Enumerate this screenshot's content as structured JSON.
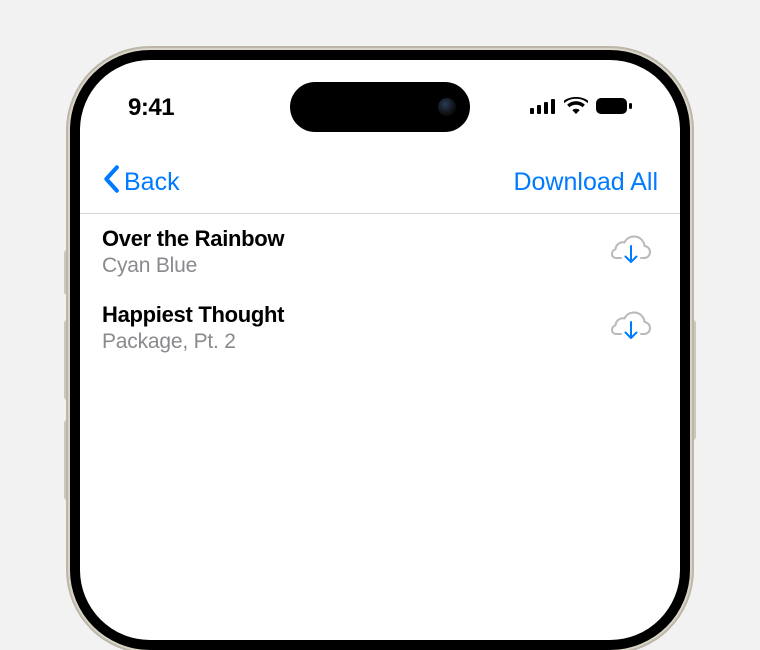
{
  "statusbar": {
    "time": "9:41"
  },
  "nav": {
    "back_label": "Back",
    "download_all_label": "Download All"
  },
  "list": {
    "items": [
      {
        "title": "Over the Rainbow",
        "subtitle": "Cyan Blue"
      },
      {
        "title": "Happiest Thought",
        "subtitle": "Package, Pt. 2"
      }
    ]
  },
  "colors": {
    "accent": "#007aff",
    "secondary_text": "#8a8a8e"
  }
}
